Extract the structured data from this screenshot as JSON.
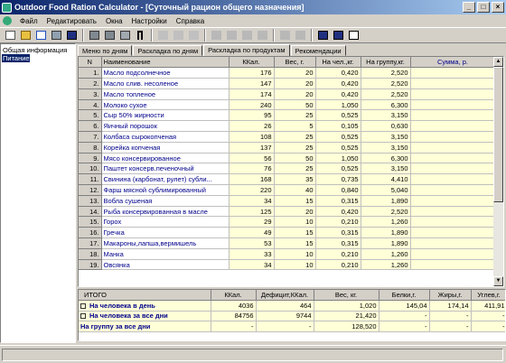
{
  "window": {
    "title": "Outdoor Food Ration Calculator - [Суточный рацион общего назначения]",
    "min": "_",
    "max": "□",
    "close": "×"
  },
  "menu": [
    "Файл",
    "Редактировать",
    "Окна",
    "Настройки",
    "Справка"
  ],
  "toolbar": [
    "new-icon",
    "open-icon",
    "close-doc-icon",
    "print-icon",
    "save-icon",
    "print-preview-icon",
    "print2-icon",
    "print3-icon",
    "bookmark-icon",
    "cut-icon",
    "copy-icon",
    "paste-icon",
    "add-row-icon",
    "remove-row-icon",
    "insert-row-icon",
    "table-icon",
    "grid-icon",
    "move-up-icon",
    "move-down-icon",
    "tile-icon",
    "cascade-icon",
    "window-icon"
  ],
  "sidebar": {
    "items": [
      "Общая информация",
      "Питание"
    ]
  },
  "tabs": [
    "Меню по дням",
    "Раскладка по дням",
    "Раскладка по продуктам",
    "Рекомендации"
  ],
  "table": {
    "headers": [
      "N",
      "Наименование",
      "ККал.",
      "Вес, г.",
      "На чел.,кг.",
      "На группу,кг.",
      "Сумма, р."
    ],
    "rows": [
      [
        "1.",
        "Масло подсолнечное",
        "176",
        "20",
        "0,420",
        "2,520",
        ""
      ],
      [
        "2.",
        "Масло слив. несоленое",
        "147",
        "20",
        "0,420",
        "2,520",
        ""
      ],
      [
        "3.",
        "Масло топленое",
        "174",
        "20",
        "0,420",
        "2,520",
        ""
      ],
      [
        "4.",
        "Молоко сухое",
        "240",
        "50",
        "1,050",
        "6,300",
        ""
      ],
      [
        "5.",
        "Сыр 50% жирности",
        "95",
        "25",
        "0,525",
        "3,150",
        ""
      ],
      [
        "6.",
        "Яичный порошок",
        "26",
        "5",
        "0,105",
        "0,630",
        ""
      ],
      [
        "7.",
        "Колбаса сырокопченая",
        "108",
        "25",
        "0,525",
        "3,150",
        ""
      ],
      [
        "8.",
        "Корейка копченая",
        "137",
        "25",
        "0,525",
        "3,150",
        ""
      ],
      [
        "9.",
        "Мясо консервированное",
        "56",
        "50",
        "1,050",
        "6,300",
        ""
      ],
      [
        "10.",
        "Паштет консерв.печеночный",
        "76",
        "25",
        "0,525",
        "3,150",
        ""
      ],
      [
        "11.",
        "Свинина (карбонат, рулет) субли...",
        "168",
        "35",
        "0,735",
        "4,410",
        ""
      ],
      [
        "12.",
        "Фарш мясной сублимированный",
        "220",
        "40",
        "0,840",
        "5,040",
        ""
      ],
      [
        "13.",
        "Вобла сушеная",
        "34",
        "15",
        "0,315",
        "1,890",
        ""
      ],
      [
        "14.",
        "Рыба консервированная в масле",
        "125",
        "20",
        "0,420",
        "2,520",
        ""
      ],
      [
        "15.",
        "Горох",
        "29",
        "10",
        "0,210",
        "1,260",
        ""
      ],
      [
        "16.",
        "Гречка",
        "49",
        "15",
        "0,315",
        "1,890",
        ""
      ],
      [
        "17.",
        "Макароны,лапша,вермишель",
        "53",
        "15",
        "0,315",
        "1,890",
        ""
      ],
      [
        "18.",
        "Манка",
        "33",
        "10",
        "0,210",
        "1,260",
        ""
      ],
      [
        "19.",
        "Овсянка",
        "34",
        "10",
        "0,210",
        "1,260",
        ""
      ]
    ]
  },
  "summary": {
    "headers": [
      "ИТОГО",
      "ККал.",
      "Дефицит,ККал.",
      "Вес, кг.",
      "Белки,г.",
      "Жиры,г.",
      "Углев,г."
    ],
    "rows": [
      [
        "На человека в день",
        "4036",
        "464",
        "1,020",
        "145,04",
        "174,14",
        "411,91"
      ],
      [
        "На человека за все дни",
        "84756",
        "9744",
        "21,420",
        "-",
        "-",
        "-"
      ],
      [
        "На группу за все дни",
        "-",
        "-",
        "128,520",
        "-",
        "-",
        "-"
      ]
    ]
  }
}
